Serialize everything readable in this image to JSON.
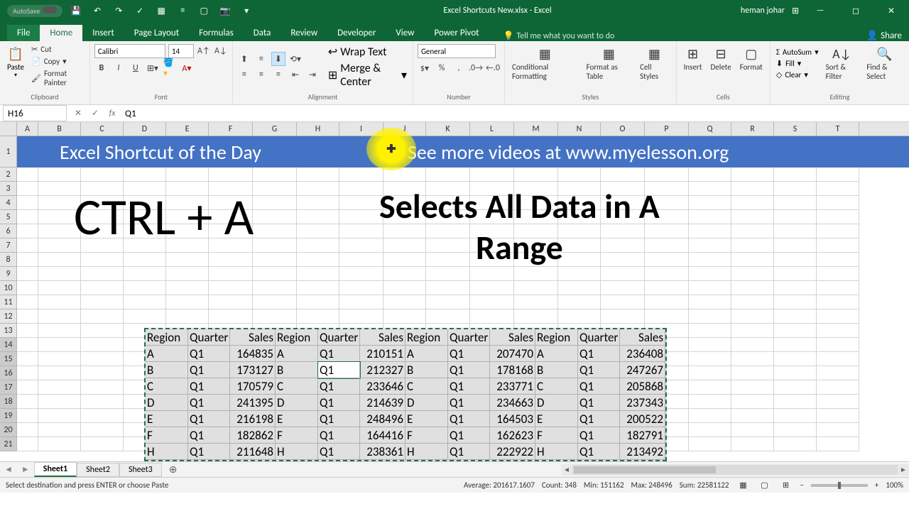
{
  "titlebar": {
    "autosave": "AutoSave",
    "filename": "Excel Shortcuts New.xlsx - Excel",
    "username": "heman johar"
  },
  "tabs": {
    "file": "File",
    "home": "Home",
    "insert": "Insert",
    "pagelayout": "Page Layout",
    "formulas": "Formulas",
    "data": "Data",
    "review": "Review",
    "developer": "Developer",
    "view": "View",
    "powerpivot": "Power Pivot",
    "tellme": "Tell me what you want to do",
    "share": "Share"
  },
  "ribbon": {
    "paste": "Paste",
    "cut": "Cut",
    "copy": "Copy",
    "formatpainter": "Format Painter",
    "clipboard": "Clipboard",
    "font_name": "Calibri",
    "font_size": "14",
    "font": "Font",
    "wraptext": "Wrap Text",
    "mergecenter": "Merge & Center",
    "alignment": "Alignment",
    "number_format": "General",
    "number": "Number",
    "conditional": "Conditional Formatting",
    "formatas": "Format as Table",
    "cellstyles": "Cell Styles",
    "styles": "Styles",
    "insert": "Insert",
    "delete": "Delete",
    "format": "Format",
    "cells": "Cells",
    "autosum": "AutoSum",
    "fill": "Fill",
    "clear": "Clear",
    "sortfilter": "Sort & Filter",
    "findselect": "Find & Select",
    "editing": "Editing"
  },
  "formula_bar": {
    "name_box": "H16",
    "formula": "Q1"
  },
  "columns": [
    "A",
    "B",
    "C",
    "D",
    "E",
    "F",
    "G",
    "H",
    "I",
    "J",
    "K",
    "L",
    "M",
    "N",
    "O",
    "P",
    "Q",
    "R",
    "S",
    "T"
  ],
  "rows": [
    "1",
    "2",
    "3",
    "4",
    "5",
    "6",
    "7",
    "8",
    "9",
    "10",
    "11",
    "12",
    "13",
    "14",
    "15",
    "16",
    "17",
    "18",
    "19",
    "20",
    "21"
  ],
  "banner": {
    "left": "Excel Shortcut of the Day",
    "right": "See more videos at www.myelesson.org"
  },
  "overlay": {
    "shortcut": "CTRL + A",
    "description": "Selects All Data in A Range"
  },
  "table": {
    "headers": [
      "Region",
      "Quarter",
      "Sales",
      "Region",
      "Quarter",
      "Sales",
      "Region",
      "Quarter",
      "Sales",
      "Region",
      "Quarter",
      "Sales"
    ],
    "rows": [
      [
        "A",
        "Q1",
        "164835",
        "A",
        "Q1",
        "210151",
        "A",
        "Q1",
        "207470",
        "A",
        "Q1",
        "236408"
      ],
      [
        "B",
        "Q1",
        "173127",
        "B",
        "Q1",
        "212327",
        "B",
        "Q1",
        "178168",
        "B",
        "Q1",
        "247267"
      ],
      [
        "C",
        "Q1",
        "170579",
        "C",
        "Q1",
        "233646",
        "C",
        "Q1",
        "233771",
        "C",
        "Q1",
        "205868"
      ],
      [
        "D",
        "Q1",
        "241395",
        "D",
        "Q1",
        "214639",
        "D",
        "Q1",
        "234663",
        "D",
        "Q1",
        "237343"
      ],
      [
        "E",
        "Q1",
        "216198",
        "E",
        "Q1",
        "248496",
        "E",
        "Q1",
        "164503",
        "E",
        "Q1",
        "200522"
      ],
      [
        "F",
        "Q1",
        "182862",
        "F",
        "Q1",
        "164416",
        "F",
        "Q1",
        "162623",
        "F",
        "Q1",
        "182791"
      ],
      [
        "H",
        "Q1",
        "211648",
        "H",
        "Q1",
        "238361",
        "H",
        "Q1",
        "222922",
        "H",
        "Q1",
        "213492"
      ]
    ]
  },
  "sheets": {
    "s1": "Sheet1",
    "s2": "Sheet2",
    "s3": "Sheet3"
  },
  "status": {
    "msg": "Select destination and press ENTER or choose Paste",
    "avg_label": "Average:",
    "avg": "201617.1607",
    "count_label": "Count:",
    "count": "348",
    "min_label": "Min:",
    "min": "151162",
    "max_label": "Max:",
    "max": "248496",
    "sum_label": "Sum:",
    "sum": "22581122",
    "zoom": "100%"
  }
}
